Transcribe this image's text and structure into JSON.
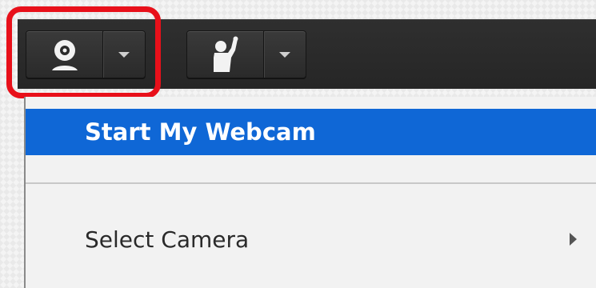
{
  "toolbar": {
    "webcam_button": {
      "icon": "webcam-icon",
      "dropdown_icon": "chevron-down-icon"
    },
    "raise_hand_button": {
      "icon": "raise-hand-icon",
      "dropdown_icon": "chevron-down-icon"
    }
  },
  "menu": {
    "items": [
      {
        "label": "Start My Webcam"
      },
      {
        "label": "Select Camera"
      }
    ]
  },
  "colors": {
    "highlight": "#e8101a",
    "menu_selection": "#0f67d6",
    "toolbar": "#2b2b2b"
  }
}
